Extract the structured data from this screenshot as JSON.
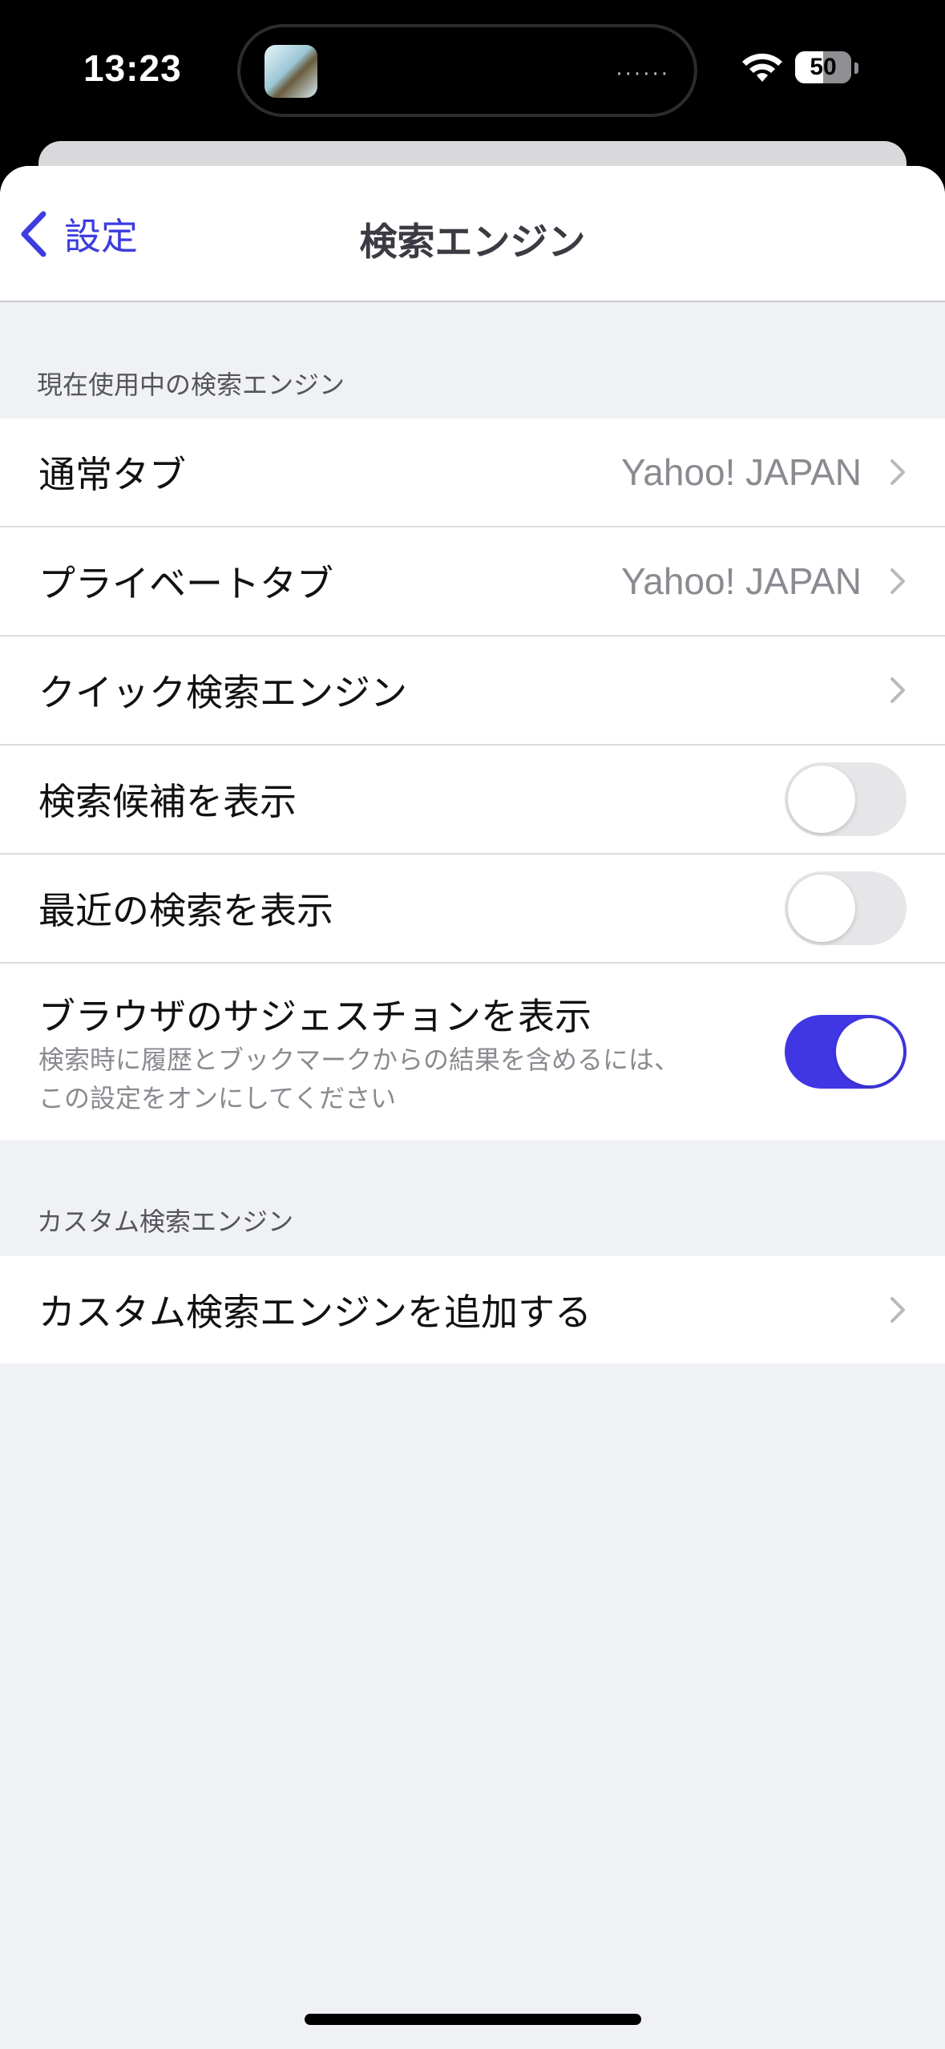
{
  "status": {
    "time": "13:23",
    "battery": "50",
    "island_dots": "······"
  },
  "nav": {
    "back_label": "設定",
    "title": "検索エンジン"
  },
  "sections": {
    "current": {
      "header": "現在使用中の検索エンジン",
      "rows": {
        "normal_tab": {
          "label": "通常タブ",
          "value": "Yahoo! JAPAN"
        },
        "private_tab": {
          "label": "プライベートタブ",
          "value": "Yahoo! JAPAN"
        },
        "quick_search": {
          "label": "クイック検索エンジン"
        },
        "search_suggestions": {
          "label": "検索候補を表示",
          "enabled": false
        },
        "recent_searches": {
          "label": "最近の検索を表示",
          "enabled": false
        },
        "browser_suggestions": {
          "label": "ブラウザのサジェスチョンを表示",
          "sub_line1": "検索時に履歴とブックマークからの結果を含めるには、",
          "sub_line2": "この設定をオンにしてください",
          "enabled": true
        }
      }
    },
    "custom": {
      "header": "カスタム検索エンジン",
      "rows": {
        "add_custom": {
          "label": "カスタム検索エンジンを追加する"
        }
      }
    }
  },
  "colors": {
    "accent": "#4036e4",
    "background": "#f0f1f4"
  }
}
